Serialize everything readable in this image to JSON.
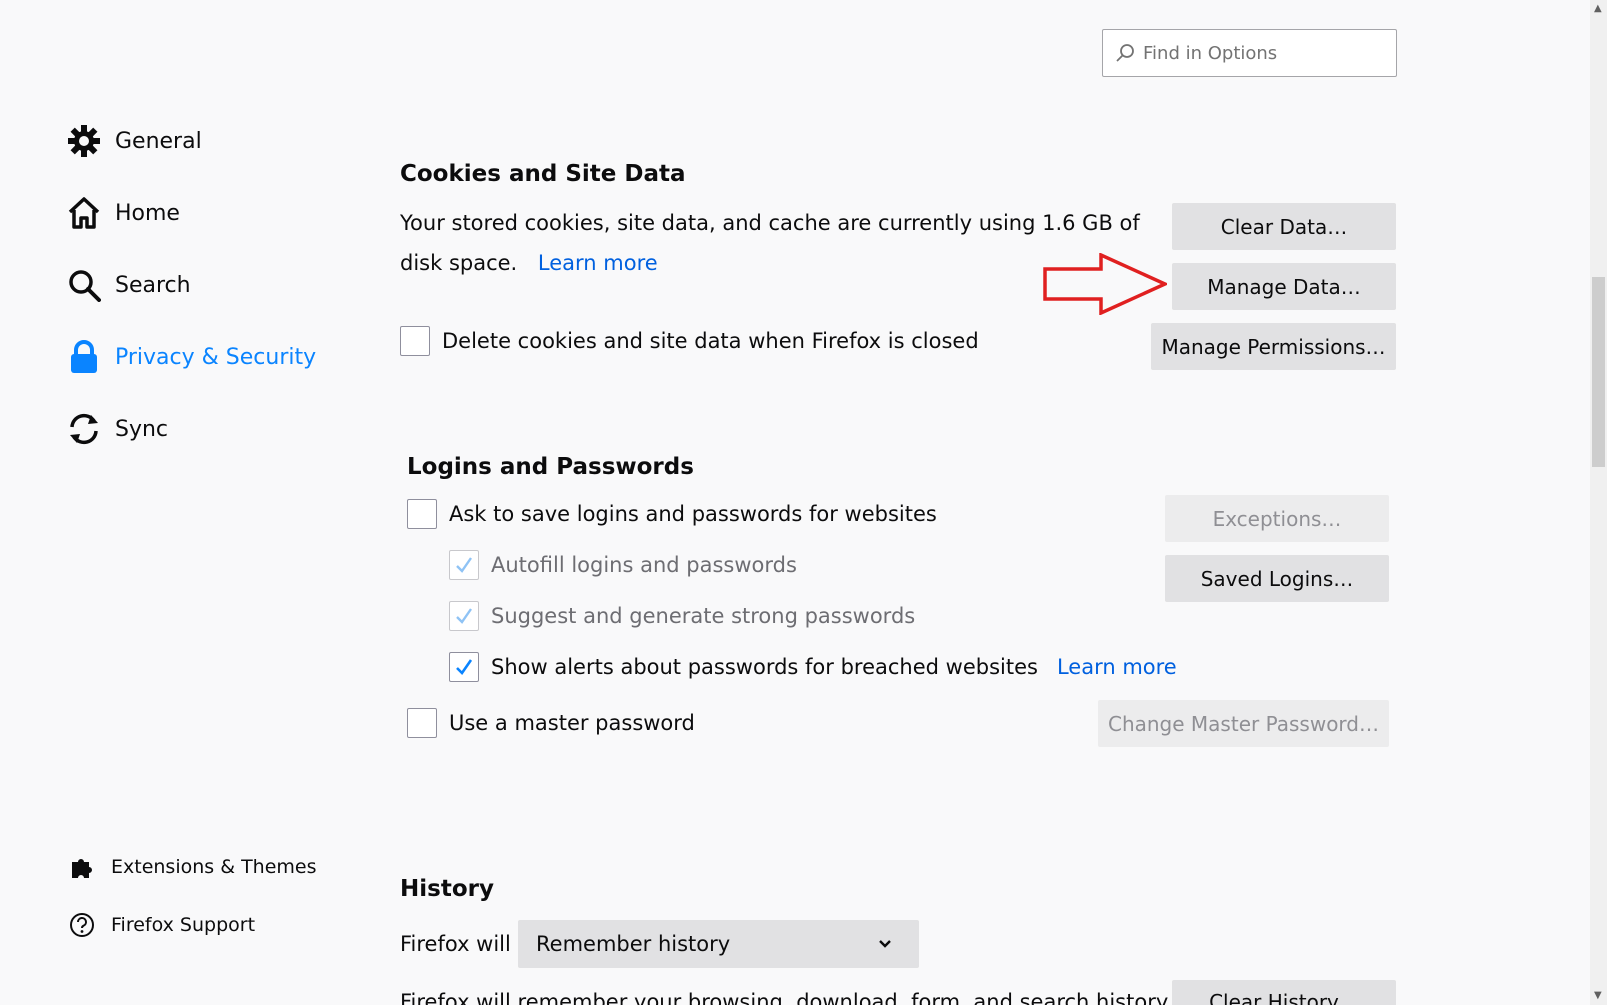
{
  "search": {
    "placeholder": "Find in Options"
  },
  "sidebar": {
    "items": [
      {
        "label": "General",
        "icon": "gear-icon"
      },
      {
        "label": "Home",
        "icon": "home-icon"
      },
      {
        "label": "Search",
        "icon": "search-icon"
      },
      {
        "label": "Privacy & Security",
        "icon": "lock-icon",
        "selected": true
      },
      {
        "label": "Sync",
        "icon": "sync-icon"
      }
    ],
    "footer": [
      {
        "label": "Extensions & Themes",
        "icon": "puzzle-icon"
      },
      {
        "label": "Firefox Support",
        "icon": "help-icon"
      }
    ]
  },
  "cookies": {
    "title": "Cookies and Site Data",
    "description": "Your stored cookies, site data, and cache are currently using 1.6 GB of disk space.",
    "learn_more": "Learn more",
    "clear_data": "Clear Data…",
    "manage_data": "Manage Data…",
    "manage_permissions": "Manage Permissions…",
    "delete_checkbox": "Delete cookies and site data when Firefox is closed"
  },
  "logins": {
    "title": "Logins and Passwords",
    "ask_save": "Ask to save logins and passwords for websites",
    "autofill": "Autofill logins and passwords",
    "suggest": "Suggest and generate strong passwords",
    "breach_alerts": "Show alerts about passwords for breached websites",
    "learn_more": "Learn more",
    "master_password": "Use a master password",
    "exceptions": "Exceptions…",
    "saved_logins": "Saved Logins…",
    "change_master": "Change Master Password…"
  },
  "history": {
    "title": "History",
    "firefox_will": "Firefox will",
    "mode": "Remember history",
    "description": "Firefox will remember your browsing, download, form, and search history.",
    "clear_history": "Clear History…"
  },
  "colors": {
    "accent": "#0a84ff",
    "link": "#0060df",
    "annotation": "#e02020"
  }
}
